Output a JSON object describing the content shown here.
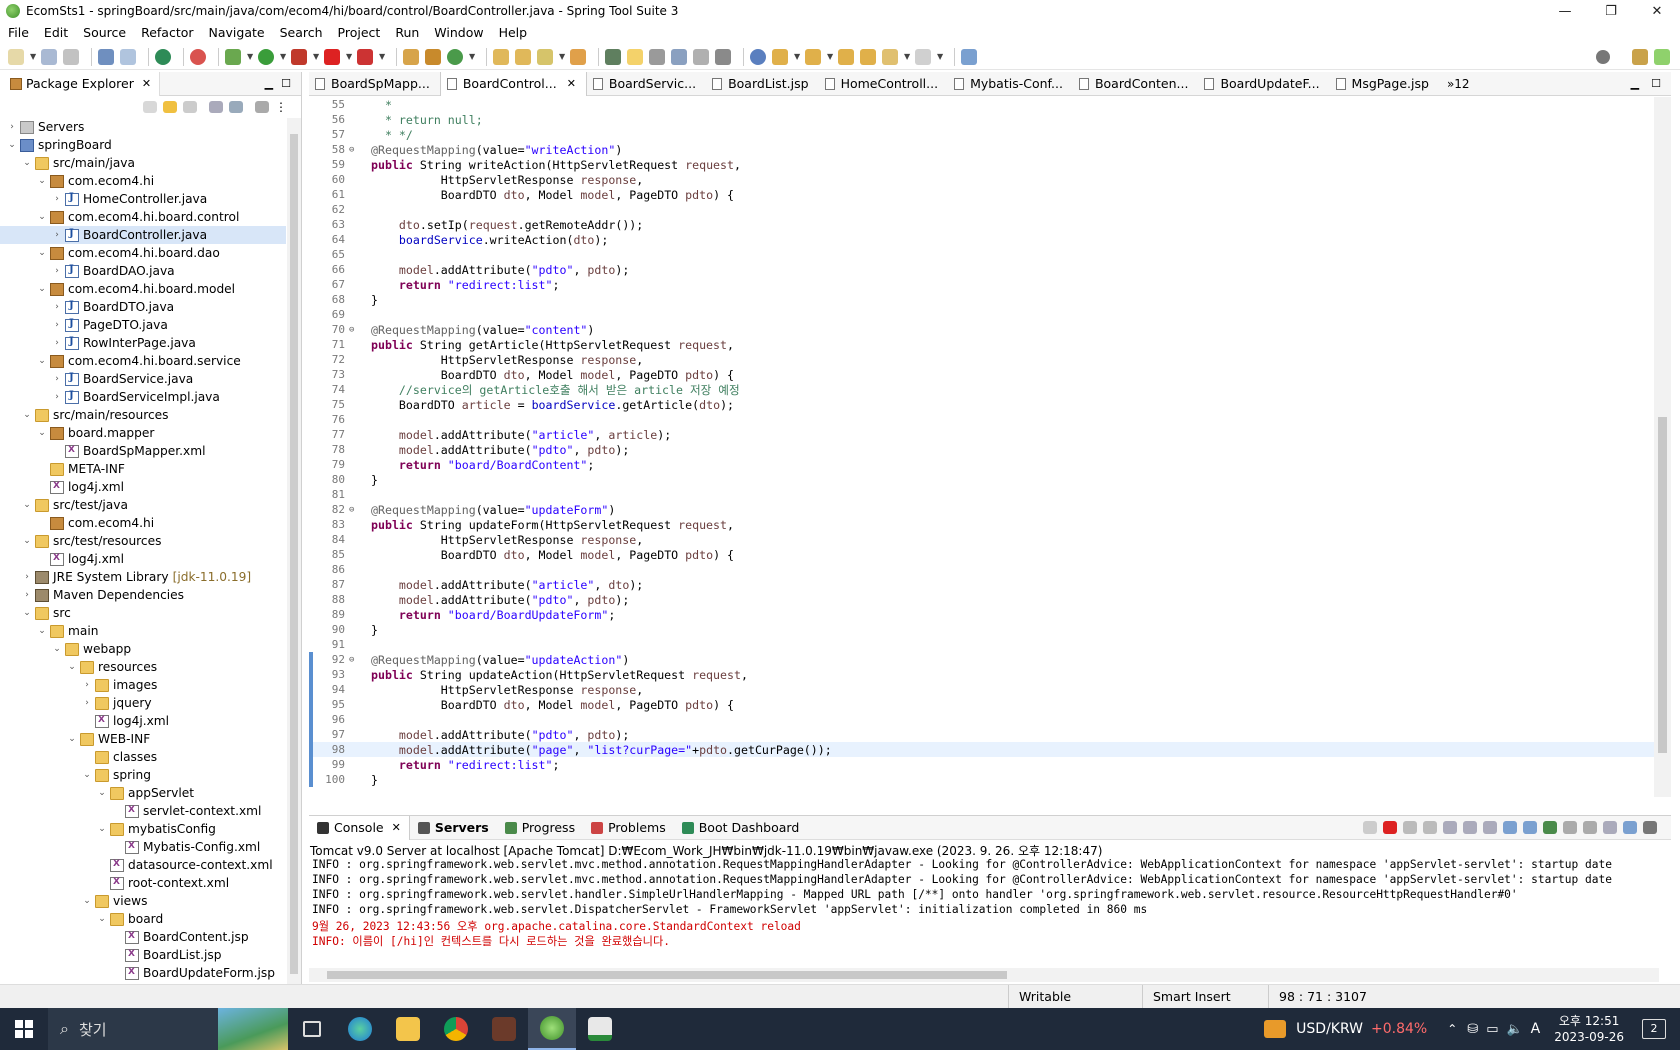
{
  "window": {
    "title": "EcomSts1 - springBoard/src/main/java/com/ecom4/hi/board/control/BoardController.java - Spring Tool Suite 3",
    "minimize": "—",
    "maximize": "❐",
    "close": "✕"
  },
  "menu": [
    "File",
    "Edit",
    "Source",
    "Refactor",
    "Navigate",
    "Search",
    "Project",
    "Run",
    "Window",
    "Help"
  ],
  "package_explorer": {
    "title": "Package Explorer",
    "tree": [
      {
        "level": 0,
        "tw": "›",
        "icon": "server",
        "label": "Servers"
      },
      {
        "level": 0,
        "tw": "⌄",
        "icon": "project",
        "label": "springBoard"
      },
      {
        "level": 1,
        "tw": "⌄",
        "icon": "folder",
        "label": "src/main/java"
      },
      {
        "level": 2,
        "tw": "⌄",
        "icon": "pkg",
        "label": "com.ecom4.hi"
      },
      {
        "level": 3,
        "tw": "›",
        "icon": "java",
        "label": "HomeController.java"
      },
      {
        "level": 2,
        "tw": "⌄",
        "icon": "pkg",
        "label": "com.ecom4.hi.board.control"
      },
      {
        "level": 3,
        "tw": "›",
        "icon": "java",
        "label": "BoardController.java",
        "selected": true
      },
      {
        "level": 2,
        "tw": "⌄",
        "icon": "pkg",
        "label": "com.ecom4.hi.board.dao"
      },
      {
        "level": 3,
        "tw": "›",
        "icon": "java",
        "label": "BoardDAO.java"
      },
      {
        "level": 2,
        "tw": "⌄",
        "icon": "pkg",
        "label": "com.ecom4.hi.board.model"
      },
      {
        "level": 3,
        "tw": "›",
        "icon": "java",
        "label": "BoardDTO.java"
      },
      {
        "level": 3,
        "tw": "›",
        "icon": "java",
        "label": "PageDTO.java"
      },
      {
        "level": 3,
        "tw": "›",
        "icon": "java",
        "label": "RowInterPage.java"
      },
      {
        "level": 2,
        "tw": "⌄",
        "icon": "pkg",
        "label": "com.ecom4.hi.board.service"
      },
      {
        "level": 3,
        "tw": "›",
        "icon": "java",
        "label": "BoardService.java"
      },
      {
        "level": 3,
        "tw": "›",
        "icon": "java",
        "label": "BoardServiceImpl.java"
      },
      {
        "level": 1,
        "tw": "⌄",
        "icon": "folder",
        "label": "src/main/resources"
      },
      {
        "level": 2,
        "tw": "⌄",
        "icon": "pkg",
        "label": "board.mapper"
      },
      {
        "level": 3,
        "tw": "",
        "icon": "xml",
        "label": "BoardSpMapper.xml"
      },
      {
        "level": 2,
        "tw": "",
        "icon": "folder",
        "label": "META-INF"
      },
      {
        "level": 2,
        "tw": "",
        "icon": "xml",
        "label": "log4j.xml"
      },
      {
        "level": 1,
        "tw": "⌄",
        "icon": "folder",
        "label": "src/test/java"
      },
      {
        "level": 2,
        "tw": "",
        "icon": "pkg",
        "label": "com.ecom4.hi"
      },
      {
        "level": 1,
        "tw": "⌄",
        "icon": "folder",
        "label": "src/test/resources"
      },
      {
        "level": 2,
        "tw": "",
        "icon": "xml",
        "label": "log4j.xml"
      },
      {
        "level": 1,
        "tw": "›",
        "icon": "lib",
        "label": "JRE System Library",
        "suffix": "[jdk-11.0.19]"
      },
      {
        "level": 1,
        "tw": "›",
        "icon": "lib",
        "label": "Maven Dependencies"
      },
      {
        "level": 1,
        "tw": "⌄",
        "icon": "folder",
        "label": "src"
      },
      {
        "level": 2,
        "tw": "⌄",
        "icon": "folder",
        "label": "main"
      },
      {
        "level": 3,
        "tw": "⌄",
        "icon": "folder",
        "label": "webapp"
      },
      {
        "level": 4,
        "tw": "⌄",
        "icon": "folder",
        "label": "resources"
      },
      {
        "level": 5,
        "tw": "›",
        "icon": "folder",
        "label": "images"
      },
      {
        "level": 5,
        "tw": "›",
        "icon": "folder",
        "label": "jquery"
      },
      {
        "level": 5,
        "tw": "",
        "icon": "xml",
        "label": "log4j.xml"
      },
      {
        "level": 4,
        "tw": "⌄",
        "icon": "folder",
        "label": "WEB-INF"
      },
      {
        "level": 5,
        "tw": "",
        "icon": "folder",
        "label": "classes"
      },
      {
        "level": 5,
        "tw": "⌄",
        "icon": "folder",
        "label": "spring"
      },
      {
        "level": 6,
        "tw": "⌄",
        "icon": "folder",
        "label": "appServlet"
      },
      {
        "level": 7,
        "tw": "",
        "icon": "xml",
        "label": "servlet-context.xml"
      },
      {
        "level": 6,
        "tw": "⌄",
        "icon": "folder",
        "label": "mybatisConfig"
      },
      {
        "level": 7,
        "tw": "",
        "icon": "xml",
        "label": "Mybatis-Config.xml"
      },
      {
        "level": 6,
        "tw": "",
        "icon": "xml",
        "label": "datasource-context.xml"
      },
      {
        "level": 6,
        "tw": "",
        "icon": "xml",
        "label": "root-context.xml"
      },
      {
        "level": 5,
        "tw": "⌄",
        "icon": "folder",
        "label": "views"
      },
      {
        "level": 6,
        "tw": "⌄",
        "icon": "folder",
        "label": "board"
      },
      {
        "level": 7,
        "tw": "",
        "icon": "xml",
        "label": "BoardContent.jsp"
      },
      {
        "level": 7,
        "tw": "",
        "icon": "xml",
        "label": "BoardList.jsp"
      },
      {
        "level": 7,
        "tw": "",
        "icon": "xml",
        "label": "BoardUpdateForm.jsp"
      }
    ]
  },
  "editor": {
    "tabs": [
      {
        "label": "BoardSpMapp...",
        "active": false
      },
      {
        "label": "BoardControl...",
        "active": true,
        "closable": "✕"
      },
      {
        "label": "BoardServic...",
        "active": false
      },
      {
        "label": "BoardList.jsp",
        "active": false
      },
      {
        "label": "HomeControll...",
        "active": false
      },
      {
        "label": "Mybatis-Conf...",
        "active": false
      },
      {
        "label": "BoardConten...",
        "active": false
      },
      {
        "label": "BoardUpdateF...",
        "active": false
      },
      {
        "label": "MsgPage.jsp",
        "active": false
      }
    ],
    "overflow": "»12",
    "lines": [
      {
        "n": "55",
        "html": "<span class=\"cm\">  *</span>"
      },
      {
        "n": "56",
        "html": "<span class=\"cm\">  * return null;</span>"
      },
      {
        "n": "57",
        "html": "<span class=\"cm\">  * */</span>"
      },
      {
        "n": "58",
        "fold": "⊖",
        "html": "<span class=\"an\">@RequestMapping</span>(value=<span class=\"st\">\"writeAction\"</span>)"
      },
      {
        "n": "59",
        "html": "<span class=\"kw\">public</span> String writeAction(HttpServletRequest <span class=\"pm\">request</span>,"
      },
      {
        "n": "60",
        "html": "          HttpServletResponse <span class=\"pm\">response</span>,"
      },
      {
        "n": "61",
        "html": "          BoardDTO <span class=\"pm\">dto</span>, Model <span class=\"pm\">model</span>, PageDTO <span class=\"pm\">pdto</span>) {"
      },
      {
        "n": "62",
        "html": ""
      },
      {
        "n": "63",
        "html": "    <span class=\"pm\">dto</span>.setIp(<span class=\"pm\">request</span>.getRemoteAddr());"
      },
      {
        "n": "64",
        "html": "    <span class=\"fd\">boardService</span>.writeAction(<span class=\"pm\">dto</span>);"
      },
      {
        "n": "65",
        "html": ""
      },
      {
        "n": "66",
        "html": "    <span class=\"pm\">model</span>.addAttribute(<span class=\"st\">\"pdto\"</span>, <span class=\"pm\">pdto</span>);"
      },
      {
        "n": "67",
        "html": "    <span class=\"kw\">return</span> <span class=\"st\">\"redirect:list\"</span>;"
      },
      {
        "n": "68",
        "html": "}"
      },
      {
        "n": "69",
        "html": ""
      },
      {
        "n": "70",
        "fold": "⊖",
        "html": "<span class=\"an\">@RequestMapping</span>(value=<span class=\"st\">\"content\"</span>)"
      },
      {
        "n": "71",
        "html": "<span class=\"kw\">public</span> String getArticle(HttpServletRequest <span class=\"pm\">request</span>,"
      },
      {
        "n": "72",
        "html": "          HttpServletResponse <span class=\"pm\">response</span>,"
      },
      {
        "n": "73",
        "html": "          BoardDTO <span class=\"pm\">dto</span>, Model <span class=\"pm\">model</span>, PageDTO <span class=\"pm\">pdto</span>) {"
      },
      {
        "n": "74",
        "html": "    <span class=\"cm\">//service의 getArticle호출 해서 받은 article 저장 예정</span>"
      },
      {
        "n": "75",
        "html": "    BoardDTO <span class=\"pm\">article</span> = <span class=\"fd\">boardService</span>.getArticle(<span class=\"pm\">dto</span>);"
      },
      {
        "n": "76",
        "html": ""
      },
      {
        "n": "77",
        "html": "    <span class=\"pm\">model</span>.addAttribute(<span class=\"st\">\"article\"</span>, <span class=\"pm\">article</span>);"
      },
      {
        "n": "78",
        "html": "    <span class=\"pm\">model</span>.addAttribute(<span class=\"st\">\"pdto\"</span>, <span class=\"pm\">pdto</span>);"
      },
      {
        "n": "79",
        "html": "    <span class=\"kw\">return</span> <span class=\"st\">\"board/BoardContent\"</span>;"
      },
      {
        "n": "80",
        "html": "}"
      },
      {
        "n": "81",
        "html": ""
      },
      {
        "n": "82",
        "fold": "⊖",
        "html": "<span class=\"an\">@RequestMapping</span>(value=<span class=\"st\">\"updateForm\"</span>)"
      },
      {
        "n": "83",
        "html": "<span class=\"kw\">public</span> String updateForm(HttpServletRequest <span class=\"pm\">request</span>,"
      },
      {
        "n": "84",
        "html": "          HttpServletResponse <span class=\"pm\">response</span>,"
      },
      {
        "n": "85",
        "html": "          BoardDTO <span class=\"pm\">dto</span>, Model <span class=\"pm\">model</span>, PageDTO <span class=\"pm\">pdto</span>) {"
      },
      {
        "n": "86",
        "html": ""
      },
      {
        "n": "87",
        "html": "    <span class=\"pm\">model</span>.addAttribute(<span class=\"st\">\"article\"</span>, <span class=\"pm\">dto</span>);"
      },
      {
        "n": "88",
        "html": "    <span class=\"pm\">model</span>.addAttribute(<span class=\"st\">\"pdto\"</span>, <span class=\"pm\">pdto</span>);"
      },
      {
        "n": "89",
        "html": "    <span class=\"kw\">return</span> <span class=\"st\">\"board/BoardUpdateForm\"</span>;"
      },
      {
        "n": "90",
        "html": "}"
      },
      {
        "n": "91",
        "html": ""
      },
      {
        "n": "92",
        "fold": "⊖",
        "mark": true,
        "html": "<span class=\"an\">@RequestMapping</span>(value=<span class=\"st\">\"updateAction\"</span>)"
      },
      {
        "n": "93",
        "mark": true,
        "html": "<span class=\"kw\">public</span> String updateAction(HttpServletRequest <span class=\"pm\">request</span>,"
      },
      {
        "n": "94",
        "mark": true,
        "html": "          HttpServletResponse <span class=\"pm\">response</span>,"
      },
      {
        "n": "95",
        "mark": true,
        "html": "          BoardDTO <span class=\"pm\">dto</span>, Model <span class=\"pm\">model</span>, PageDTO <span class=\"pm\">pdto</span>) {"
      },
      {
        "n": "96",
        "mark": true,
        "html": ""
      },
      {
        "n": "97",
        "mark": true,
        "html": "    <span class=\"pm\">model</span>.addAttribute(<span class=\"st\">\"pdto\"</span>, <span class=\"pm\">pdto</span>);"
      },
      {
        "n": "98",
        "mark": true,
        "cur": true,
        "html": "    <span class=\"pm\">model</span>.addAttribute(<span class=\"st\">\"page\"</span>, <span class=\"st\">\"list?curPage=\"</span>+<span class=\"pm\">pdto</span>.getCurPage());"
      },
      {
        "n": "99",
        "mark": true,
        "html": "    <span class=\"kw\">return</span> <span class=\"st\">\"redirect:list\"</span>;"
      },
      {
        "n": "100",
        "mark": true,
        "html": "}"
      }
    ]
  },
  "console": {
    "tabs": [
      {
        "label": "Console",
        "active": true,
        "closable": "✕"
      },
      {
        "label": "Servers",
        "bold": true
      },
      {
        "label": "Progress"
      },
      {
        "label": "Problems"
      },
      {
        "label": "Boot Dashboard"
      }
    ],
    "header": "Tomcat v9.0 Server at localhost [Apache Tomcat] D:₩Ecom_Work_JH₩bin₩jdk-11.0.19₩bin₩javaw.exe  (2023. 9. 26. 오후 12:18:47)",
    "lines": [
      {
        "text": "INFO : org.springframework.web.servlet.mvc.method.annotation.RequestMappingHandlerAdapter - Looking for @ControllerAdvice: WebApplicationContext for namespace 'appServlet-servlet': startup date",
        "red": false
      },
      {
        "text": "INFO : org.springframework.web.servlet.mvc.method.annotation.RequestMappingHandlerAdapter - Looking for @ControllerAdvice: WebApplicationContext for namespace 'appServlet-servlet': startup date",
        "red": false
      },
      {
        "text": "INFO : org.springframework.web.servlet.handler.SimpleUrlHandlerMapping - Mapped URL path [/**] onto handler 'org.springframework.web.servlet.resource.ResourceHttpRequestHandler#0'",
        "red": false
      },
      {
        "text": "INFO : org.springframework.web.servlet.DispatcherServlet - FrameworkServlet 'appServlet': initialization completed in 860 ms",
        "red": false
      },
      {
        "text": "9월 26, 2023 12:43:56 오후 org.apache.catalina.core.StandardContext reload",
        "red": true
      },
      {
        "text": "INFO: 이름이 [/hi]인 컨텍스트를 다시 로드하는 것을 완료했습니다.",
        "red": true
      }
    ]
  },
  "status": {
    "writable": "Writable",
    "insert": "Smart Insert",
    "position": "98 : 71 : 3107"
  },
  "taskbar": {
    "search_placeholder": "찾기",
    "currency": "USD/KRW",
    "currency_change": "+0.84%",
    "time": "오후 12:51",
    "date": "2023-09-26",
    "ime": "A",
    "notifications": "2"
  },
  "colors": {
    "keyword": "#7f0055",
    "string": "#2a00ff",
    "comment": "#3f7f5f",
    "field": "#0000c0",
    "console_error": "#d00000",
    "taskbar": "#1f2a3a",
    "currency_up": "#ff6b6b"
  }
}
